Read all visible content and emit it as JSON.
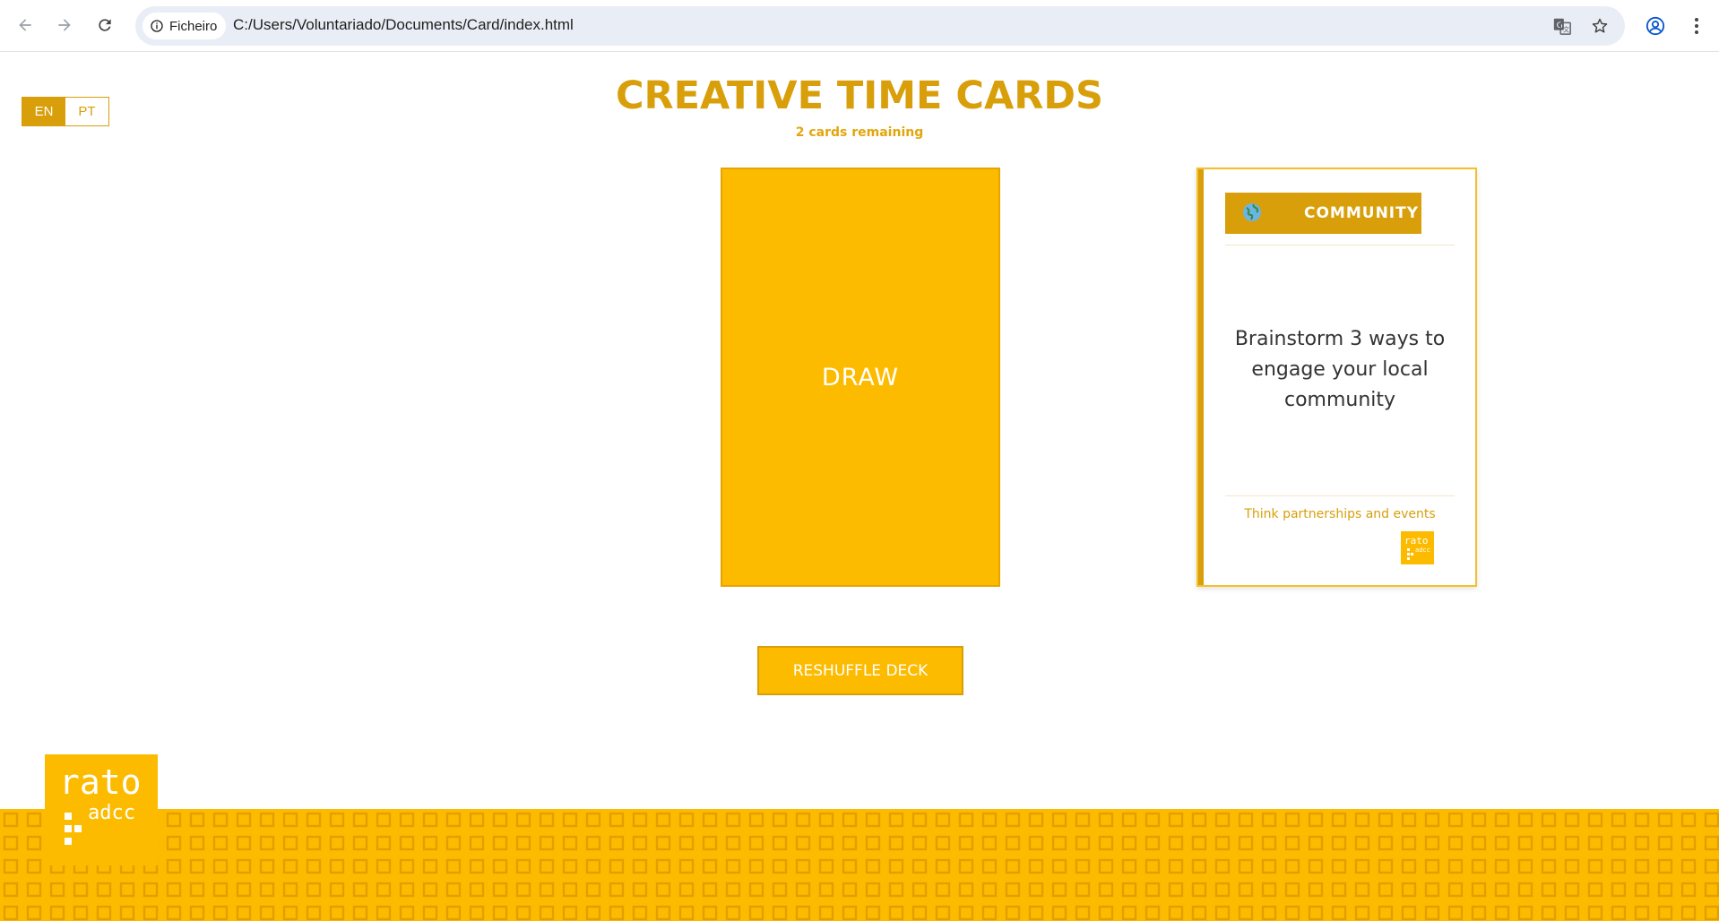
{
  "browser": {
    "site_chip": "Ficheiro",
    "url": "C:/Users/Voluntariado/Documents/Card/index.html",
    "icons": [
      "back-icon",
      "forward-icon",
      "reload-icon",
      "info-icon",
      "translate-icon",
      "star-icon",
      "profile-icon",
      "more-icon"
    ]
  },
  "language": {
    "options": [
      {
        "label": "EN",
        "active": true
      },
      {
        "label": "PT",
        "active": false
      }
    ]
  },
  "header": {
    "title": "CREATIVE TIME CARDS",
    "remaining": "2 cards remaining"
  },
  "deck": {
    "label": "DRAW"
  },
  "card": {
    "category_icon": "globe-icon",
    "category": "COMMUNITY",
    "prompt": "Brainstorm 3 ways to engage your local community",
    "hint": "Think partnerships and events",
    "logo_text": "rato adcc"
  },
  "actions": {
    "reshuffle": "RESHUFFLE DECK"
  },
  "footer": {
    "logo_text": "rato adcc"
  },
  "colors": {
    "accent": "#d89f0a",
    "card_yellow": "#fdbb00",
    "text_dark": "#333333"
  }
}
